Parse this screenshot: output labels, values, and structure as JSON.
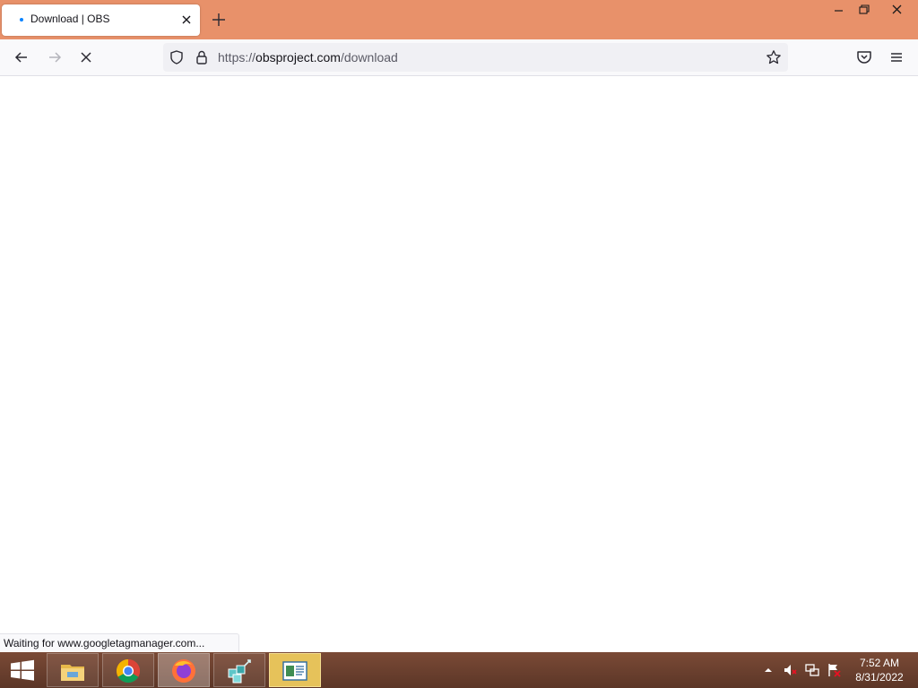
{
  "browser": {
    "tab": {
      "title": "Download | OBS"
    },
    "url": {
      "scheme": "https://",
      "domain": "obsproject.com",
      "path": "/download"
    }
  },
  "status_bar": {
    "text": "Waiting for www.googletagmanager.com..."
  },
  "taskbar": {
    "items": [
      "file-explorer",
      "chrome",
      "firefox",
      "network-app",
      "document-app"
    ],
    "clock": {
      "time": "7:52 AM",
      "date": "8/31/2022"
    }
  },
  "colors": {
    "titlebar": "#e8916a",
    "loading_dot": "#0a84ff",
    "taskbar": "#6b3f2e"
  }
}
